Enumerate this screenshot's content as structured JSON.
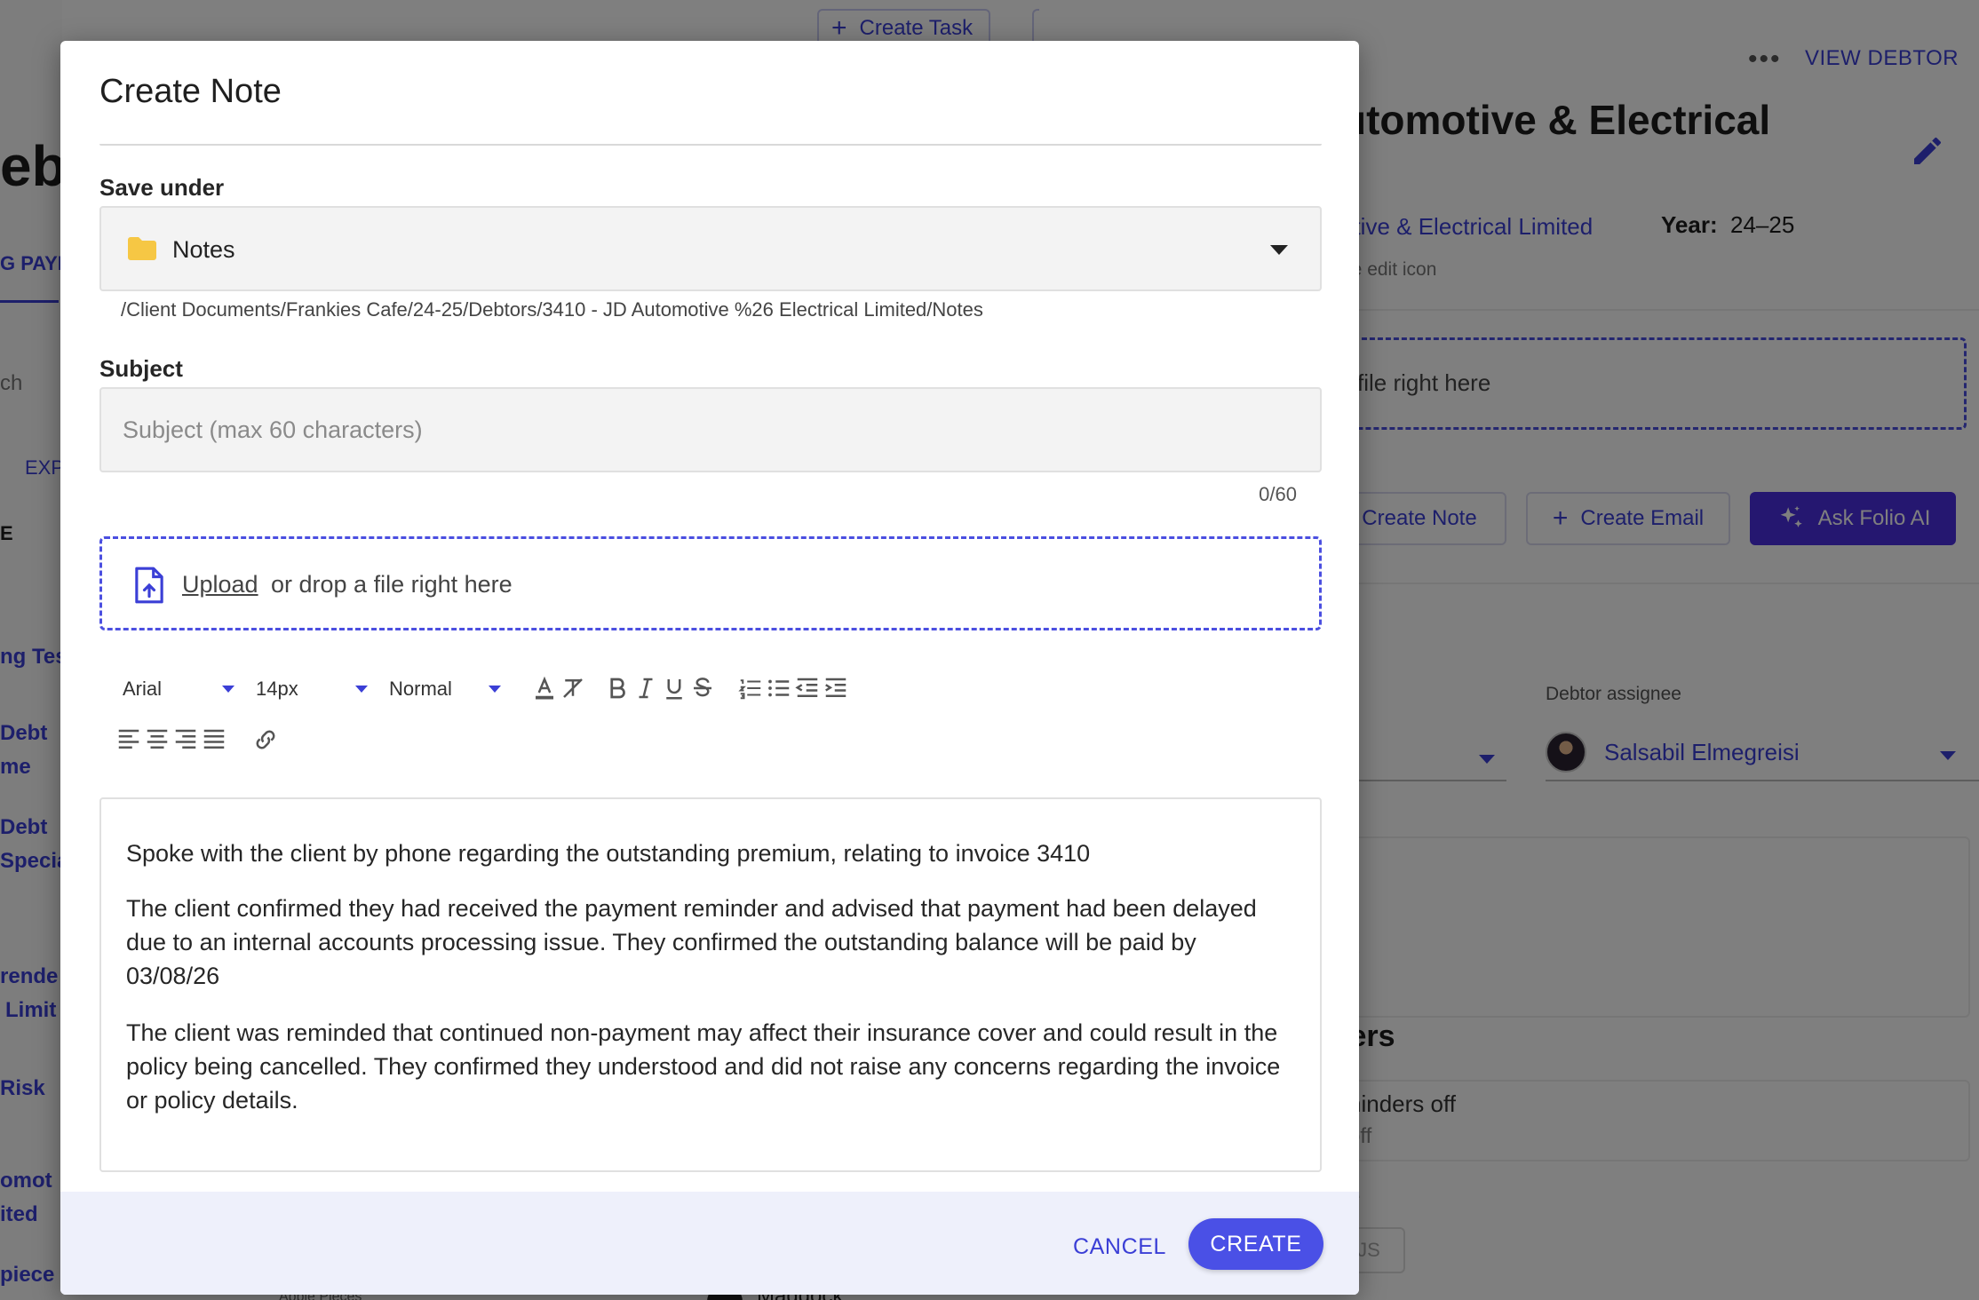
{
  "background": {
    "top_button_label": "Create Task",
    "view_debtor_label": "VIEW DEBTOR",
    "debtor_title": "utomotive & Electrical",
    "company_link": "otive & Electrical Limited",
    "year_label": "Year:",
    "year_value": "24–25",
    "edit_hint": "ne edit icon",
    "drop_text": "file right here",
    "create_note_label": "Create Note",
    "create_email_label": "Create Email",
    "ask_ai_label": "Ask Folio AI",
    "assignee_label": "Debtor assignee",
    "assignee_name": "Salsabil Elmegreisi",
    "box_fragment": "s",
    "section_heading": "lers",
    "reminders_line1": "ninders off",
    "reminders_line2": "off",
    "fragment_e": "e",
    "status_fragment": "JS",
    "left_fragments": [
      "ebt",
      "G PAYI",
      "ch",
      "EXP",
      "E",
      "ng Tes",
      "Debt",
      "me",
      "Debt",
      "Specia",
      "rende",
      "Limit",
      "Risk",
      "omot",
      "ited",
      "piece",
      "Apple Pieces",
      "Maddock"
    ]
  },
  "modal": {
    "title": "Create Note",
    "save_under_label": "Save under",
    "folder_value": "Notes",
    "folder_path": "/Client Documents/Frankies Cafe/24-25/Debtors/3410 - JD Automotive %26 Electrical Limited/Notes",
    "subject_label": "Subject",
    "subject_placeholder": "Subject (max 60 characters)",
    "subject_value": "",
    "char_count": "0/60",
    "upload_link": "Upload",
    "upload_text": "or drop a file right here",
    "toolbar": {
      "font": "Arial",
      "size": "14px",
      "style": "Normal"
    },
    "editor_paragraphs": [
      "Spoke with the client by phone regarding the outstanding premium, relating to invoice 3410",
      "The client confirmed they had received the payment reminder and advised that payment had been delayed due to an internal accounts processing issue. They confirmed the outstanding balance will be paid by 03/08/26",
      "The client was reminded that continued non-payment may affect their insurance cover and could result in the policy being cancelled. They confirmed they understood and did not raise any concerns regarding the invoice or policy details."
    ],
    "cancel_label": "CANCEL",
    "create_label": "CREATE"
  },
  "colors": {
    "accent": "#4a50e6",
    "link": "#3b3fd6",
    "ai_button": "#4a2ee0",
    "footer_bg": "#eef0fb",
    "folder_icon": "#f6c744"
  }
}
